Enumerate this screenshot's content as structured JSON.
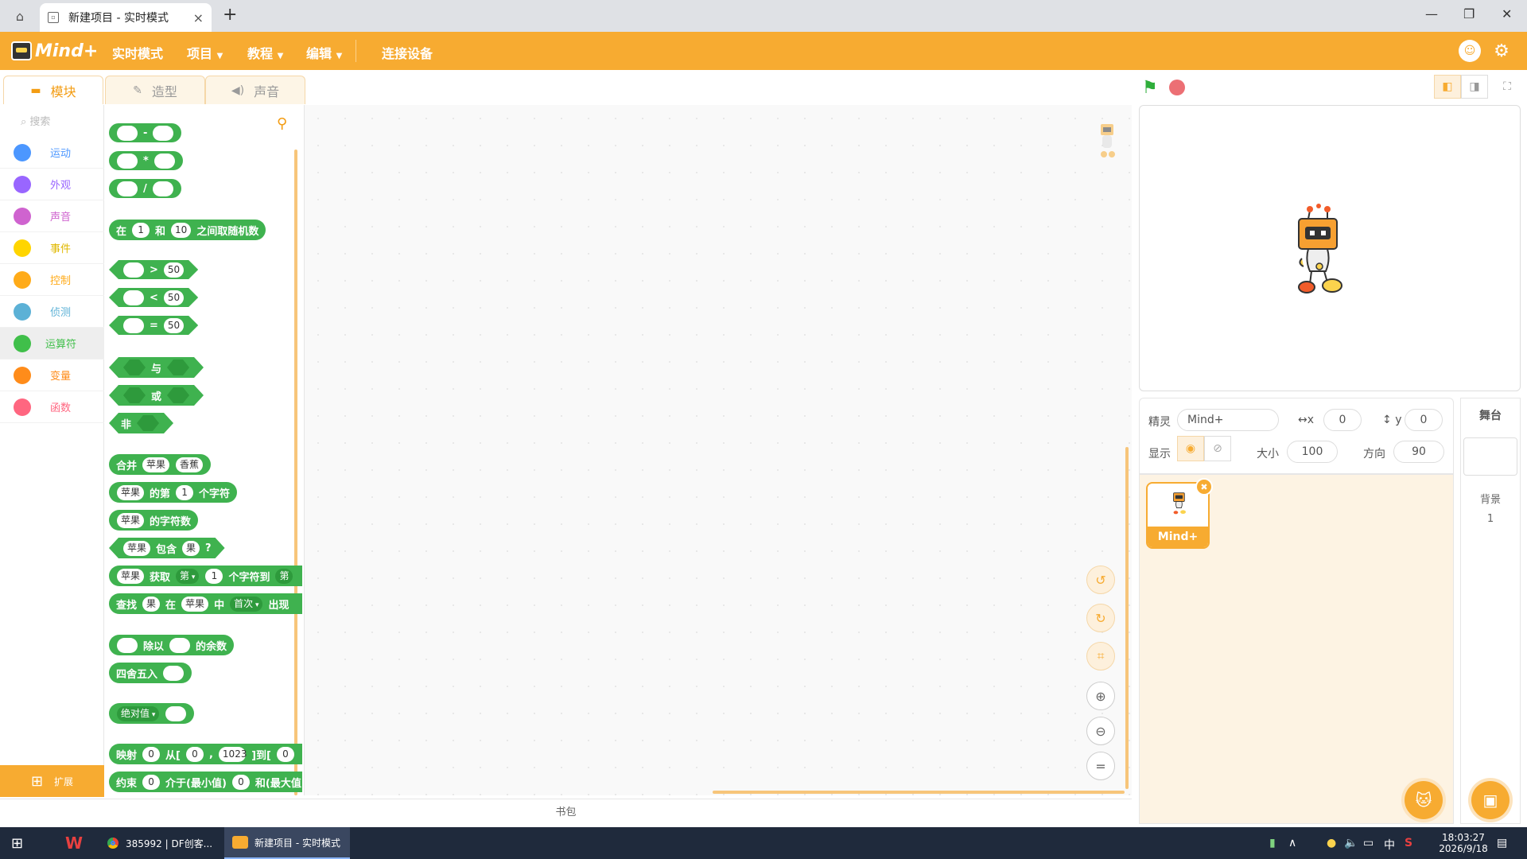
{
  "browser": {
    "tab_title": "新建项目 - 实时模式",
    "tab_close": "×",
    "new_tab": "+",
    "minimize": "—",
    "restore": "❐",
    "close": "✕"
  },
  "menubar": {
    "logo": "Mind+",
    "items": [
      "实时模式",
      "项目",
      "教程",
      "编辑",
      "连接设备"
    ]
  },
  "tabs": [
    "模块",
    "造型",
    "声音"
  ],
  "search_placeholder": "搜索",
  "categories": [
    {
      "label": "运动",
      "color": "#4c97ff"
    },
    {
      "label": "外观",
      "color": "#9966ff"
    },
    {
      "label": "声音",
      "color": "#cf63cf"
    },
    {
      "label": "事件",
      "color": "#ffd500"
    },
    {
      "label": "控制",
      "color": "#ffab19"
    },
    {
      "label": "侦测",
      "color": "#5cb1d6"
    },
    {
      "label": "运算符",
      "color": "#40bf4a"
    },
    {
      "label": "变量",
      "color": "#ff8c1a"
    },
    {
      "label": "函数",
      "color": "#ff6680"
    }
  ],
  "extend_label": "扩展",
  "blocks": {
    "sub": "-",
    "mul": "*",
    "div": "/",
    "random": {
      "a": "在",
      "v1": "1",
      "b": "和",
      "v2": "10",
      "c": "之间取随机数"
    },
    "gt": {
      "op": ">",
      "v": "50"
    },
    "lt": {
      "op": "<",
      "v": "50"
    },
    "eq": {
      "op": "=",
      "v": "50"
    },
    "and": "与",
    "or": "或",
    "not": "非",
    "join": {
      "a": "合并",
      "v1": "苹果",
      "v2": "香蕉"
    },
    "letter": {
      "v1": "苹果",
      "a": "的第",
      "v2": "1",
      "b": "个字符"
    },
    "length": {
      "v1": "苹果",
      "a": "的字符数"
    },
    "contains": {
      "v1": "苹果",
      "a": "包含",
      "v2": "果",
      "b": "?"
    },
    "substr": {
      "v1": "苹果",
      "a": "获取",
      "v2": "第",
      "v3": "1",
      "b": "个字符到",
      "c": "第"
    },
    "find": {
      "a": "查找",
      "v1": "果",
      "b": "在",
      "v2": "苹果",
      "c": "中",
      "v3": "首次",
      "d": "出现"
    },
    "mod": {
      "a": "除以",
      "b": "的余数"
    },
    "round": "四舍五入",
    "abs": "绝对值",
    "map": {
      "a": "映射",
      "v1": "0",
      "b": "从[",
      "v2": "0",
      "c": ",",
      "v3": "1023",
      "d": "]到[",
      "v4": "0"
    },
    "constrain": {
      "a": "约束",
      "v1": "0",
      "b": "介于(最小值)",
      "v2": "0",
      "c": "和(最大值)"
    }
  },
  "backpack": "书包",
  "sprite": {
    "label_sprite": "精灵",
    "name": "Mind+",
    "label_x": "x",
    "x": "0",
    "label_y": "y",
    "y": "0",
    "label_show": "显示",
    "label_size": "大小",
    "size": "100",
    "label_direction": "方向",
    "direction": "90",
    "card_name": "Mind+"
  },
  "stage_panel": {
    "title": "舞台",
    "backdrop_label": "背景",
    "backdrop_count": "1"
  },
  "taskbar": {
    "chrome_item": "385992 | DF创客...",
    "mind_item": "新建项目 - 实时模式",
    "ime": "中",
    "time": "18:03:27",
    "date": "2026/9/18"
  },
  "colors": {
    "accent": "#f7ab31",
    "operators": "#40bf4a"
  }
}
